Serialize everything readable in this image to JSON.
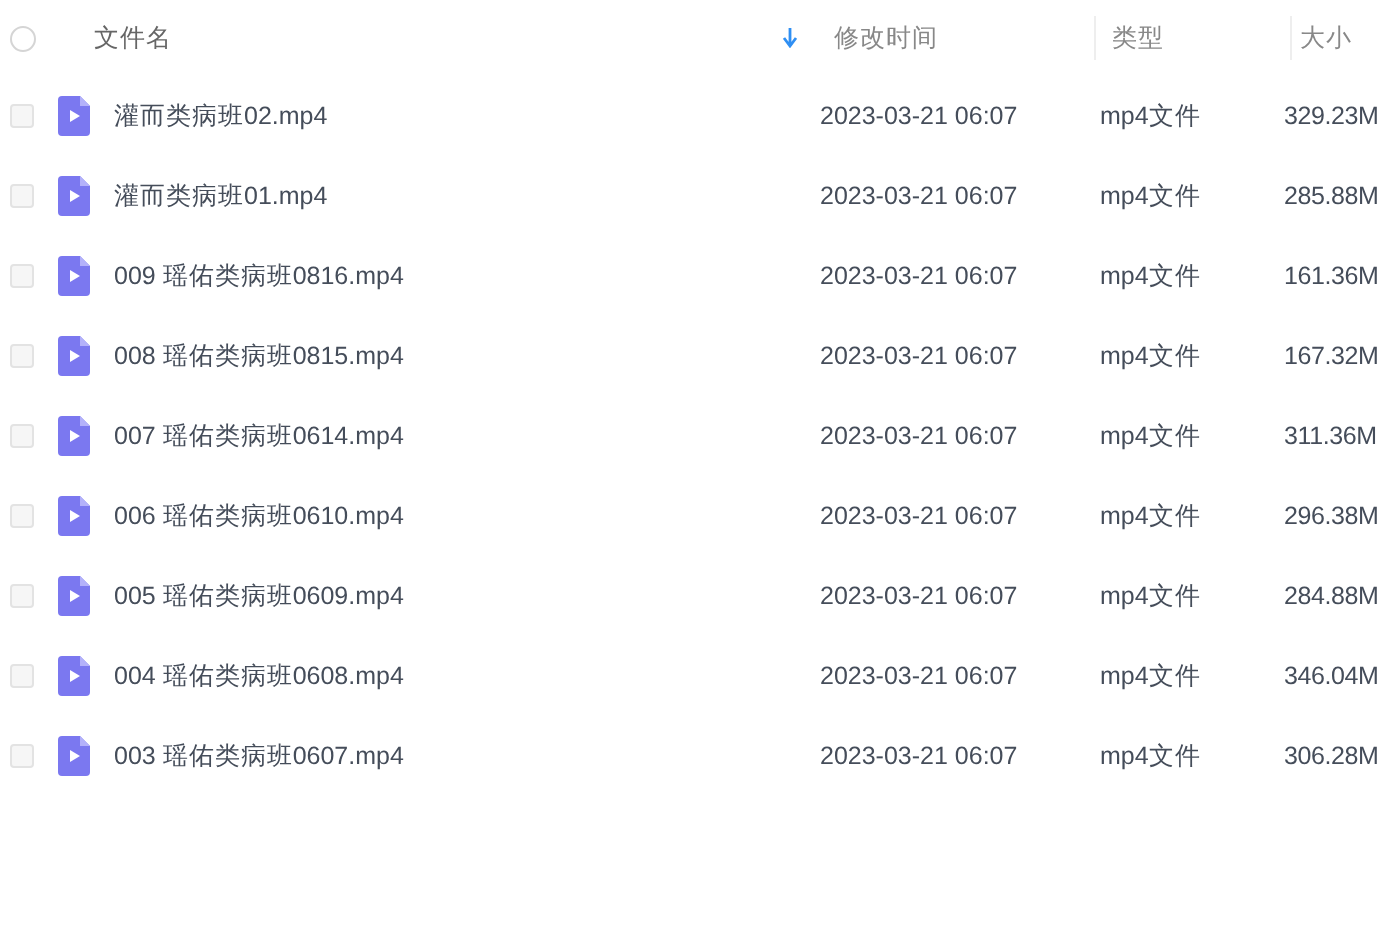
{
  "select_all": {
    "checked": false
  },
  "columns": [
    {
      "label": "文件名",
      "sorted": true
    },
    {
      "label": "修改时间",
      "sorted": false
    },
    {
      "label": "类型",
      "sorted": false
    },
    {
      "label": "大小",
      "sorted": false
    }
  ],
  "rows": [
    {
      "name": "灌而类病班02.mp4",
      "modified": "2023-03-21 06:07",
      "type": "mp4文件",
      "size": "329.23M",
      "checked": false
    },
    {
      "name": "灌而类病班01.mp4",
      "modified": "2023-03-21 06:07",
      "type": "mp4文件",
      "size": "285.88M",
      "checked": false
    },
    {
      "name": "009 瑶佑类病班0816.mp4",
      "modified": "2023-03-21 06:07",
      "type": "mp4文件",
      "size": "161.36M",
      "checked": false
    },
    {
      "name": "008 瑶佑类病班0815.mp4",
      "modified": "2023-03-21 06:07",
      "type": "mp4文件",
      "size": "167.32M",
      "checked": false
    },
    {
      "name": "007 瑶佑类病班0614.mp4",
      "modified": "2023-03-21 06:07",
      "type": "mp4文件",
      "size": "311.36M",
      "checked": false
    },
    {
      "name": "006 瑶佑类病班0610.mp4",
      "modified": "2023-03-21 06:07",
      "type": "mp4文件",
      "size": "296.38M",
      "checked": false
    },
    {
      "name": "005 瑶佑类病班0609.mp4",
      "modified": "2023-03-21 06:07",
      "type": "mp4文件",
      "size": "284.88M",
      "checked": false
    },
    {
      "name": "004 瑶佑类病班0608.mp4",
      "modified": "2023-03-21 06:07",
      "type": "mp4文件",
      "size": "346.04M",
      "checked": false
    },
    {
      "name": "003 瑶佑类病班0607.mp4",
      "modified": "2023-03-21 06:07",
      "type": "mp4文件",
      "size": "306.28M",
      "checked": false
    }
  ]
}
